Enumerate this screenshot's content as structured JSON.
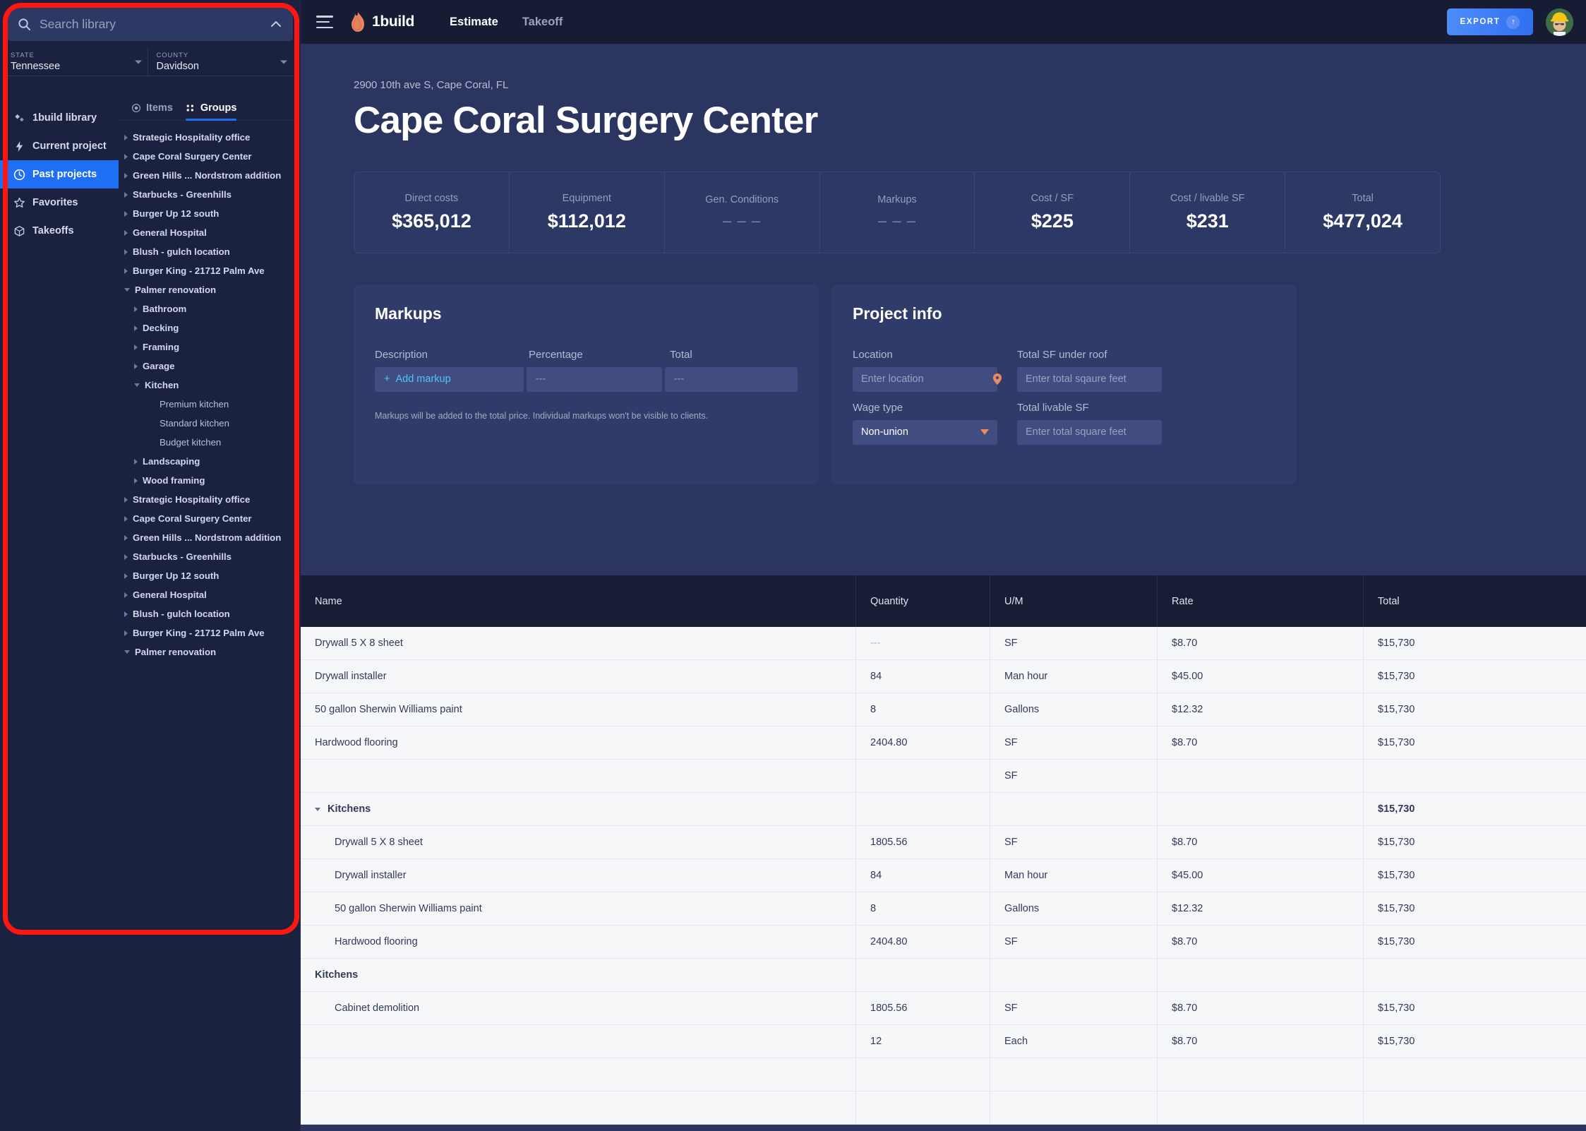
{
  "search": {
    "placeholder": "Search library",
    "value": ""
  },
  "filters": [
    {
      "label": "STATE",
      "value": "Tennessee"
    },
    {
      "label": "COUNTY",
      "value": "Davidson"
    }
  ],
  "sidebar": {
    "nav": [
      {
        "label": "1build library",
        "icon": "diamond-icon",
        "active": false
      },
      {
        "label": "Current project",
        "icon": "bolt-icon",
        "active": false
      },
      {
        "label": "Past projects",
        "icon": "clock-icon",
        "active": true
      },
      {
        "label": "Favorites",
        "icon": "star-icon",
        "active": false
      },
      {
        "label": "Takeoffs",
        "icon": "cube-icon",
        "active": false
      }
    ],
    "tabs": [
      {
        "label": "Items",
        "icon": "radio-icon",
        "active": false
      },
      {
        "label": "Groups",
        "icon": "grid-icon",
        "active": true
      }
    ],
    "tree": [
      {
        "label": "Strategic Hospitality office",
        "level": 0,
        "state": "collapsed"
      },
      {
        "label": "Cape Coral Surgery Center",
        "level": 0,
        "state": "collapsed"
      },
      {
        "label": "Green Hills ... Nordstrom addition",
        "level": 0,
        "state": "collapsed"
      },
      {
        "label": "Starbucks - Greenhills",
        "level": 0,
        "state": "collapsed"
      },
      {
        "label": "Burger Up 12 south",
        "level": 0,
        "state": "collapsed"
      },
      {
        "label": "General Hospital",
        "level": 0,
        "state": "collapsed"
      },
      {
        "label": "Blush - gulch location",
        "level": 0,
        "state": "collapsed"
      },
      {
        "label": "Burger King - 21712 Palm Ave",
        "level": 0,
        "state": "collapsed"
      },
      {
        "label": "Palmer renovation",
        "level": 0,
        "state": "expanded"
      },
      {
        "label": "Bathroom",
        "level": 1,
        "state": "collapsed"
      },
      {
        "label": "Decking",
        "level": 1,
        "state": "collapsed"
      },
      {
        "label": "Framing",
        "level": 1,
        "state": "collapsed"
      },
      {
        "label": "Garage",
        "level": 1,
        "state": "collapsed"
      },
      {
        "label": "Kitchen",
        "level": 1,
        "state": "expanded"
      },
      {
        "label": "Premium kitchen",
        "level": 2,
        "state": "leaf"
      },
      {
        "label": "Standard kitchen",
        "level": 2,
        "state": "leaf"
      },
      {
        "label": "Budget kitchen",
        "level": 2,
        "state": "leaf"
      },
      {
        "label": "Landscaping",
        "level": 1,
        "state": "collapsed"
      },
      {
        "label": "Wood framing",
        "level": 1,
        "state": "collapsed"
      },
      {
        "label": "Strategic Hospitality office",
        "level": 0,
        "state": "collapsed"
      },
      {
        "label": "Cape Coral Surgery Center",
        "level": 0,
        "state": "collapsed"
      },
      {
        "label": "Green Hills ... Nordstrom addition",
        "level": 0,
        "state": "collapsed"
      },
      {
        "label": "Starbucks - Greenhills",
        "level": 0,
        "state": "collapsed"
      },
      {
        "label": "Burger Up 12 south",
        "level": 0,
        "state": "collapsed"
      },
      {
        "label": "General Hospital",
        "level": 0,
        "state": "collapsed"
      },
      {
        "label": "Blush - gulch location",
        "level": 0,
        "state": "collapsed"
      },
      {
        "label": "Burger King - 21712 Palm Ave",
        "level": 0,
        "state": "collapsed"
      },
      {
        "label": "Palmer renovation",
        "level": 0,
        "state": "expanded"
      }
    ]
  },
  "topbar": {
    "brand": "1build",
    "nav": [
      {
        "label": "Estimate",
        "active": true
      },
      {
        "label": "Takeoff",
        "active": false
      }
    ],
    "export_label": "EXPORT",
    "export_arrow": "↑"
  },
  "hero": {
    "address": "2900 10th ave S, Cape Coral, FL",
    "title": "Cape Coral Surgery Center"
  },
  "stats": [
    {
      "label": "Direct costs",
      "value": "$365,012",
      "dim": false
    },
    {
      "label": "Equipment",
      "value": "$112,012",
      "dim": false
    },
    {
      "label": "Gen. Conditions",
      "value": "– – –",
      "dim": true
    },
    {
      "label": "Markups",
      "value": "– – –",
      "dim": true
    },
    {
      "label": "Cost / SF",
      "value": "$225",
      "dim": false
    },
    {
      "label": "Cost / livable SF",
      "value": "$231",
      "dim": false
    },
    {
      "label": "Total",
      "value": "$477,024",
      "dim": false
    }
  ],
  "markups": {
    "title": "Markups",
    "headers": [
      "Description",
      "Percentage",
      "Total"
    ],
    "add_label": "Add markup",
    "add_plus": "+",
    "percentage_value": "---",
    "total_value": "---",
    "note": "Markups will be added to the total price. Individual markups won't be visible to clients."
  },
  "project_info": {
    "title": "Project info",
    "location_label": "Location",
    "location_placeholder": "Enter location",
    "sf_roof_label": "Total SF under roof",
    "sf_roof_placeholder": "Enter total sqaure feet",
    "wage_label": "Wage type",
    "wage_value": "Non-union",
    "sf_livable_label": "Total livable SF",
    "sf_livable_placeholder": "Enter total square feet"
  },
  "table": {
    "columns": [
      "Name",
      "Quantity",
      "U/M",
      "Rate",
      "Total"
    ],
    "rows": [
      {
        "type": "item",
        "indent": 0,
        "name": "Drywall 5 X 8 sheet",
        "quantity": "---",
        "um": "SF",
        "rate": "$8.70",
        "total": "$15,730"
      },
      {
        "type": "item",
        "indent": 0,
        "name": "Drywall installer",
        "quantity": "84",
        "um": "Man hour",
        "rate": "$45.00",
        "total": "$15,730"
      },
      {
        "type": "item",
        "indent": 0,
        "name": "50 gallon Sherwin Williams paint",
        "quantity": "8",
        "um": "Gallons",
        "rate": "$12.32",
        "total": "$15,730"
      },
      {
        "type": "item",
        "indent": 0,
        "name": "Hardwood flooring",
        "quantity": "2404.80",
        "um": "SF",
        "rate": "$8.70",
        "total": "$15,730"
      },
      {
        "type": "item",
        "indent": 0,
        "name": "",
        "quantity": "",
        "um": "SF",
        "rate": "",
        "total": ""
      },
      {
        "type": "group",
        "indent": 0,
        "name": "Kitchens",
        "quantity": "",
        "um": "",
        "rate": "",
        "total": "$15,730"
      },
      {
        "type": "item",
        "indent": 1,
        "name": "Drywall 5 X 8 sheet",
        "quantity": "1805.56",
        "um": "SF",
        "rate": "$8.70",
        "total": "$15,730"
      },
      {
        "type": "item",
        "indent": 1,
        "name": "Drywall installer",
        "quantity": "84",
        "um": "Man hour",
        "rate": "$45.00",
        "total": "$15,730"
      },
      {
        "type": "item",
        "indent": 1,
        "name": "50 gallon Sherwin Williams paint",
        "quantity": "8",
        "um": "Gallons",
        "rate": "$12.32",
        "total": "$15,730"
      },
      {
        "type": "item",
        "indent": 1,
        "name": "Hardwood flooring",
        "quantity": "2404.80",
        "um": "SF",
        "rate": "$8.70",
        "total": "$15,730"
      },
      {
        "type": "grouplabel",
        "indent": 0,
        "name": "Kitchens",
        "quantity": "",
        "um": "",
        "rate": "",
        "total": ""
      },
      {
        "type": "item",
        "indent": 1,
        "name": "Cabinet demolition",
        "quantity": "1805.56",
        "um": "SF",
        "rate": "$8.70",
        "total": "$15,730"
      },
      {
        "type": "item",
        "indent": 1,
        "name": "",
        "quantity": "12",
        "um": "Each",
        "rate": "$8.70",
        "total": "$15,730"
      },
      {
        "type": "item",
        "indent": 0,
        "name": "",
        "quantity": "",
        "um": "",
        "rate": "",
        "total": ""
      },
      {
        "type": "item",
        "indent": 0,
        "name": "",
        "quantity": "",
        "um": "",
        "rate": "",
        "total": ""
      }
    ]
  },
  "colors": {
    "accent_blue": "#1f6ff5",
    "brand_orange": "#e8845c",
    "panel_bg": "#1b2240",
    "main_bg": "#2b3560",
    "highlight_red": "#fe1612"
  }
}
